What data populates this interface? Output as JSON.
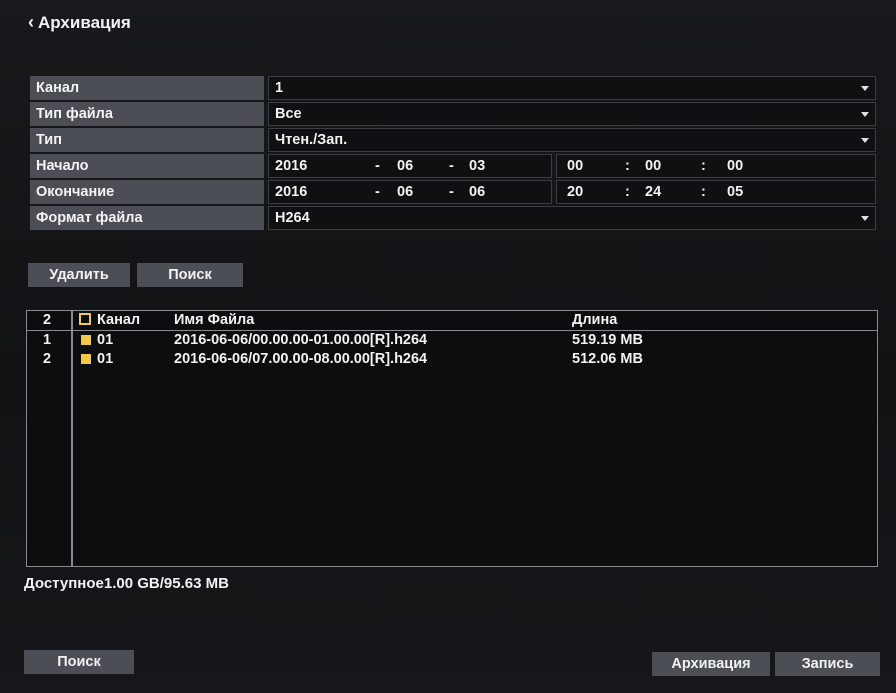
{
  "page": {
    "back_label": "Архивация"
  },
  "form": {
    "channel": {
      "label": "Канал",
      "value": "1"
    },
    "file_type": {
      "label": "Тип файла",
      "value": "Все"
    },
    "type": {
      "label": "Тип",
      "value": "Чтен./Зап."
    },
    "start": {
      "label": "Начало",
      "year": "2016",
      "month": "06",
      "day": "03",
      "hour": "00",
      "min": "00",
      "sec": "00"
    },
    "end": {
      "label": "Окончание",
      "year": "2016",
      "month": "06",
      "day": "06",
      "hour": "20",
      "min": "24",
      "sec": "05"
    },
    "format": {
      "label": "Формат файла",
      "value": "H264"
    },
    "date_sep": "-",
    "time_sep": ":"
  },
  "actions": {
    "delete": "Удалить",
    "search": "Поиск"
  },
  "list": {
    "count": "2",
    "columns": {
      "channel": "Канал",
      "name": "Имя Файла",
      "size": "Длина"
    },
    "rows": [
      {
        "index": "1",
        "channel": "01",
        "name": "2016-06-06/00.00.00-01.00.00[R].h264",
        "size": "519.19 MB"
      },
      {
        "index": "2",
        "channel": "01",
        "name": "2016-06-06/07.00.00-08.00.00[R].h264",
        "size": "512.06 MB"
      }
    ]
  },
  "status": {
    "available": "Доступное1.00 GB/95.63 MB"
  },
  "footer": {
    "search": "Поиск",
    "archive": "Архивация",
    "record": "Запись"
  },
  "colors": {
    "label_bg": "#4c4e55",
    "checkbox": "#f2c94a"
  }
}
